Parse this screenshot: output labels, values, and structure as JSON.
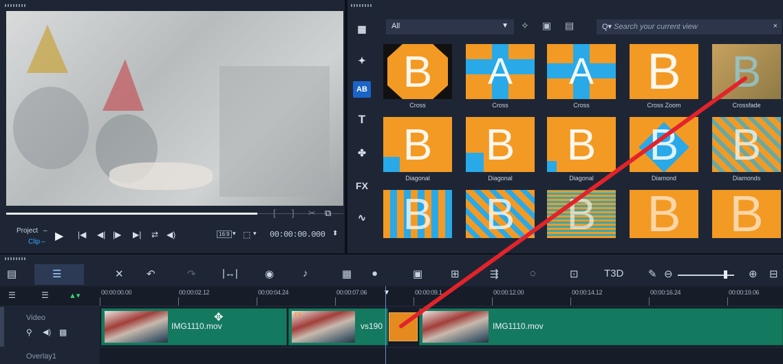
{
  "player": {
    "project_label": "Project",
    "clip_label": "Clip",
    "aspect_label": "16:9",
    "timecode": "00:00:00.000"
  },
  "library": {
    "dropdown_value": "All",
    "search_placeholder": "Search your current view",
    "sidebar_icons": [
      "media-icon",
      "instant-project-icon",
      "transition-icon",
      "title-icon",
      "graphics-icon",
      "filter-icon",
      "path-icon"
    ],
    "thumbnails": [
      {
        "label": "Cross"
      },
      {
        "label": "Cross"
      },
      {
        "label": "Cross"
      },
      {
        "label": "Cross Zoom"
      },
      {
        "label": "Crossfade"
      },
      {
        "label": "Diagonal"
      },
      {
        "label": "Diagonal"
      },
      {
        "label": "Diagonal"
      },
      {
        "label": "Diamond"
      },
      {
        "label": "Diamonds"
      },
      {
        "label": ""
      },
      {
        "label": ""
      },
      {
        "label": ""
      },
      {
        "label": ""
      },
      {
        "label": ""
      }
    ]
  },
  "timeline": {
    "ruler_ticks": [
      "00:00:00.00",
      "00:00:02.12",
      "00:00:04.24",
      "00:00:07.06",
      "00:00:09.1",
      "00:00:12.00",
      "00:00:14.12",
      "00:00:16.24",
      "00:00:19.06"
    ],
    "tracks": {
      "video_label": "Video",
      "overlay_label": "Overlay1"
    },
    "clips": [
      {
        "name": "IMG1110.mov"
      },
      {
        "name": "vs190"
      },
      {
        "name": "IMG1110.mov"
      }
    ]
  },
  "colors": {
    "accent_blue": "#1a64c8",
    "clip_green": "#147a5f",
    "transition_orange": "#e58a1e",
    "annotation_red": "#e2232a"
  }
}
